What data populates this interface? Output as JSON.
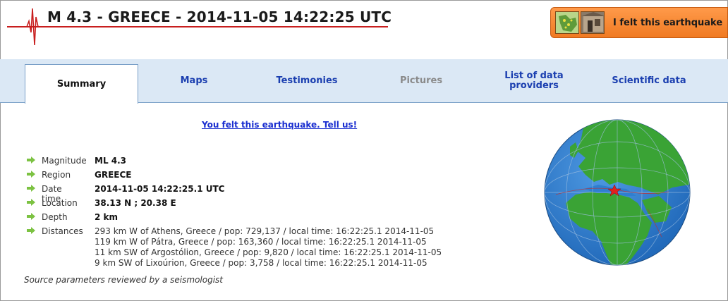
{
  "header": {
    "title": "M 4.3 - GREECE - 2014-11-05 14:22:25 UTC",
    "felt_button_label": "I felt this earthquake"
  },
  "tabs": [
    {
      "label": "Summary",
      "state": "active"
    },
    {
      "label": "Maps",
      "state": "normal"
    },
    {
      "label": "Testimonies",
      "state": "normal"
    },
    {
      "label": "Pictures",
      "state": "disabled"
    },
    {
      "label": "List of data providers",
      "state": "normal"
    },
    {
      "label": "Scientific data",
      "state": "normal"
    }
  ],
  "tell_us_link": "You felt this earthquake. Tell us!",
  "parameters": {
    "magnitude": {
      "label": "Magnitude",
      "value": "ML 4.3"
    },
    "region": {
      "label": "Region",
      "value": "GREECE"
    },
    "datetime": {
      "label": "Date time",
      "value": "2014-11-05 14:22:25.1 UTC"
    },
    "location": {
      "label": "Location",
      "value": "38.13 N ; 20.38 E"
    },
    "depth": {
      "label": "Depth",
      "value": "2 km"
    },
    "distances": {
      "label": "Distances",
      "lines": [
        "293 km W of Athens, Greece / pop: 729,137 / local time: 16:22:25.1 2014-11-05",
        "119 km W of Pátra, Greece / pop: 163,360 / local time: 16:22:25.1 2014-11-05",
        "11 km SW of Argostólion, Greece / pop: 9,820 / local time: 16:22:25.1 2014-11-05",
        "9 km SW of Lixoúrion, Greece / pop: 3,758 / local time: 16:22:25.1 2014-11-05"
      ]
    }
  },
  "reviewed_note": "Source parameters reviewed by a seismologist",
  "colors": {
    "tab_bar": "#dbe8f5",
    "link_blue": "#1b3fb0",
    "title_underline": "#c81e1e",
    "button_orange": "#f07a22",
    "bullet_green": "#7cc242",
    "ocean": "#2e7fd0",
    "land": "#3aa335",
    "epicenter": "#e02020"
  },
  "icons": {
    "logo": "seismogram-icon",
    "bullet": "arrow-right-icon",
    "epicenter": "star-icon",
    "map": "globe-icon"
  }
}
